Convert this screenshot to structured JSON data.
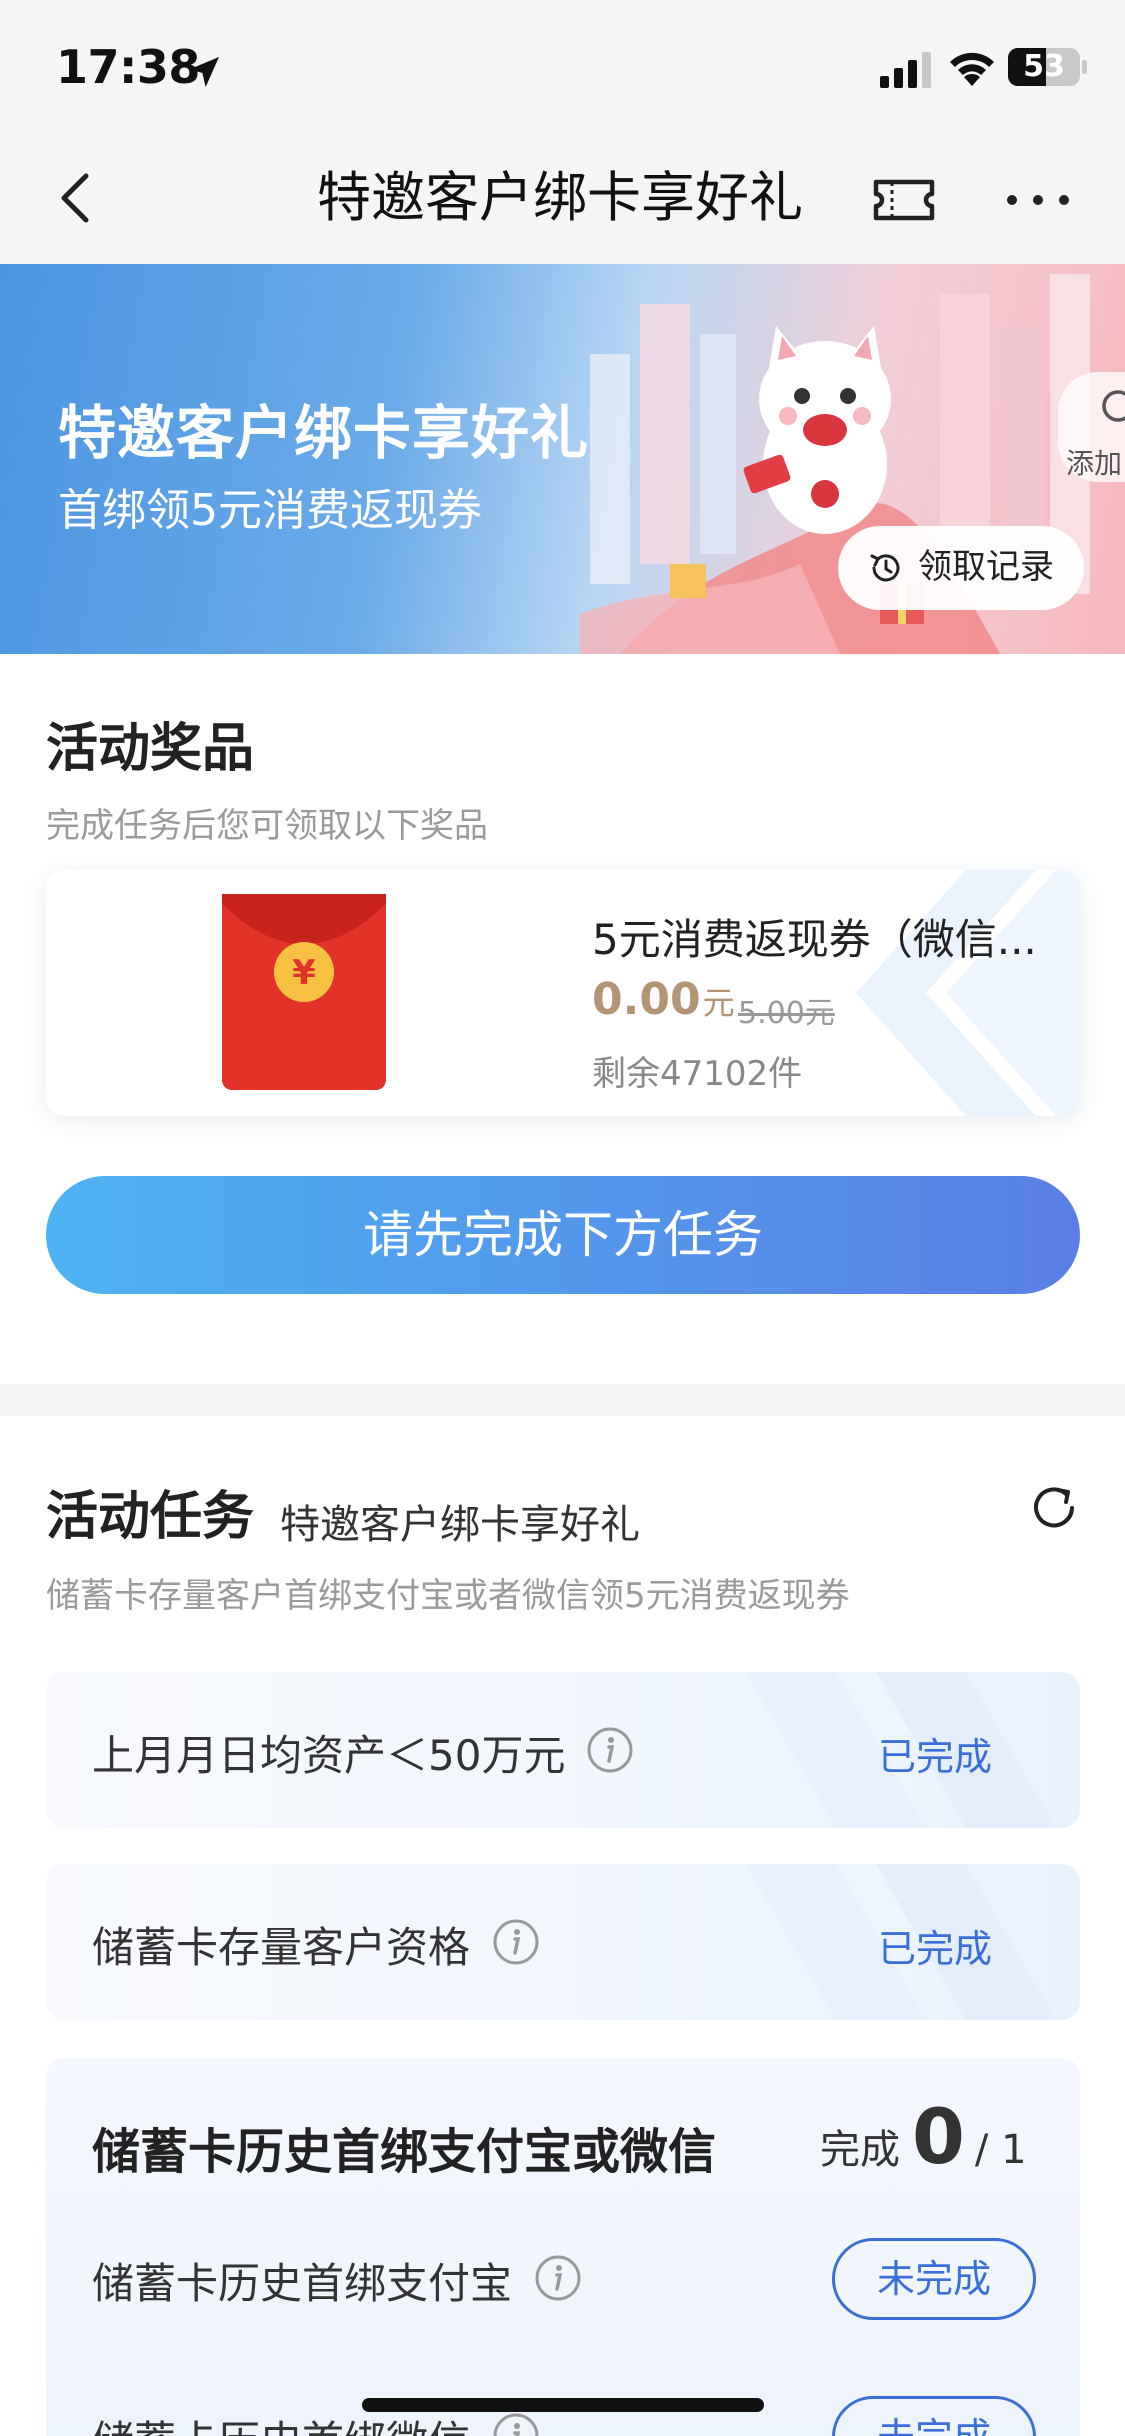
{
  "status_bar": {
    "time": "17:38",
    "battery_level": "53",
    "battery_fraction": 0.53
  },
  "nav": {
    "title": "特邀客户绑卡享好礼",
    "icons": [
      "back-chevron-icon",
      "ticket-icon",
      "more-dots-icon"
    ]
  },
  "banner": {
    "title": "特邀客户绑卡享好礼",
    "subtitle": "首绑领5元消费返现券",
    "record_label": "领取记录",
    "side_label": "添加"
  },
  "prizes": {
    "title": "活动奖品",
    "subtitle": "完成任务后您可领取以下奖品",
    "item": {
      "name": "5元消费返现券（微信...",
      "price": "0.00",
      "price_unit": "元",
      "original_price": "5.00元",
      "stock": "剩余47102件"
    },
    "cta": "请先完成下方任务"
  },
  "tasks": {
    "title": "活动任务",
    "title_extra": "特邀客户绑卡享好礼",
    "subtitle": "储蓄卡存量客户首绑支付宝或者微信领5元消费返现券",
    "rows": [
      {
        "label": "上月月日均资产＜50万元",
        "status": "已完成"
      },
      {
        "label": "储蓄卡存量客户资格",
        "status": "已完成"
      }
    ],
    "group": {
      "title": "储蓄卡历史首绑支付宝或微信",
      "progress_label": "完成",
      "progress_count": "0",
      "progress_total": "/ 1",
      "items": [
        {
          "label": "储蓄卡历史首绑支付宝",
          "status": "未完成"
        },
        {
          "label": "储蓄卡历史首绑微信",
          "status": "未完成"
        }
      ]
    }
  },
  "colors": {
    "accent_blue": "#3b6fd8",
    "price_gold": "#b39473",
    "cta_start": "#4db2f2",
    "cta_end": "#5a7fe6"
  }
}
